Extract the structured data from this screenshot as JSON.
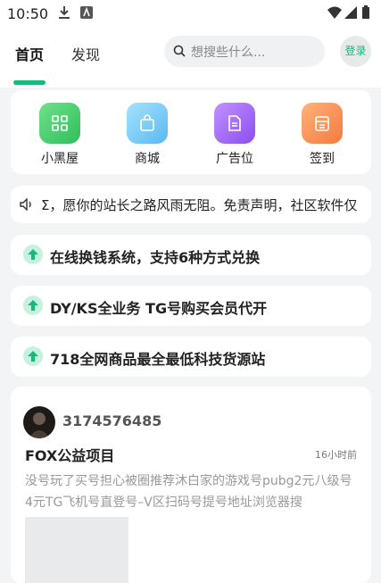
{
  "status_bar": {
    "time": "10:50"
  },
  "header": {
    "tabs": [
      {
        "label": "首页",
        "active": true
      },
      {
        "label": "发现",
        "active": false
      }
    ],
    "search_placeholder": "想搜些什么...",
    "login_label": "登录"
  },
  "nav": {
    "items": [
      {
        "label": "小黑屋",
        "icon": "grid-icon",
        "color": "#3ecb6b"
      },
      {
        "label": "商城",
        "icon": "shopping-bag-icon",
        "color": "#6cc7f5"
      },
      {
        "label": "广告位",
        "icon": "document-icon",
        "color": "#9b63f5"
      },
      {
        "label": "签到",
        "icon": "calendar-icon",
        "color": "#f8884a"
      }
    ]
  },
  "notice": {
    "text": "Σ，愿你的站长之路风雨无阻。免责声明，社区软件仅"
  },
  "promos": [
    {
      "text": "在线换钱系统，支持6种方式兑换"
    },
    {
      "text": "DY/KS全业务 TG号购买会员代开"
    },
    {
      "text": "718全网商品最全最低科技货源站"
    }
  ],
  "post": {
    "username": "3174576485",
    "title": "FOX公益项目",
    "time": "16小时前",
    "body": "没号玩了买号担心被圈推荐沐白家的游戏号pubg2元八级号4元TG飞机号直登号–V区扫码号提号地址浏览器搜"
  },
  "colors": {
    "accent": "#19b77a"
  }
}
